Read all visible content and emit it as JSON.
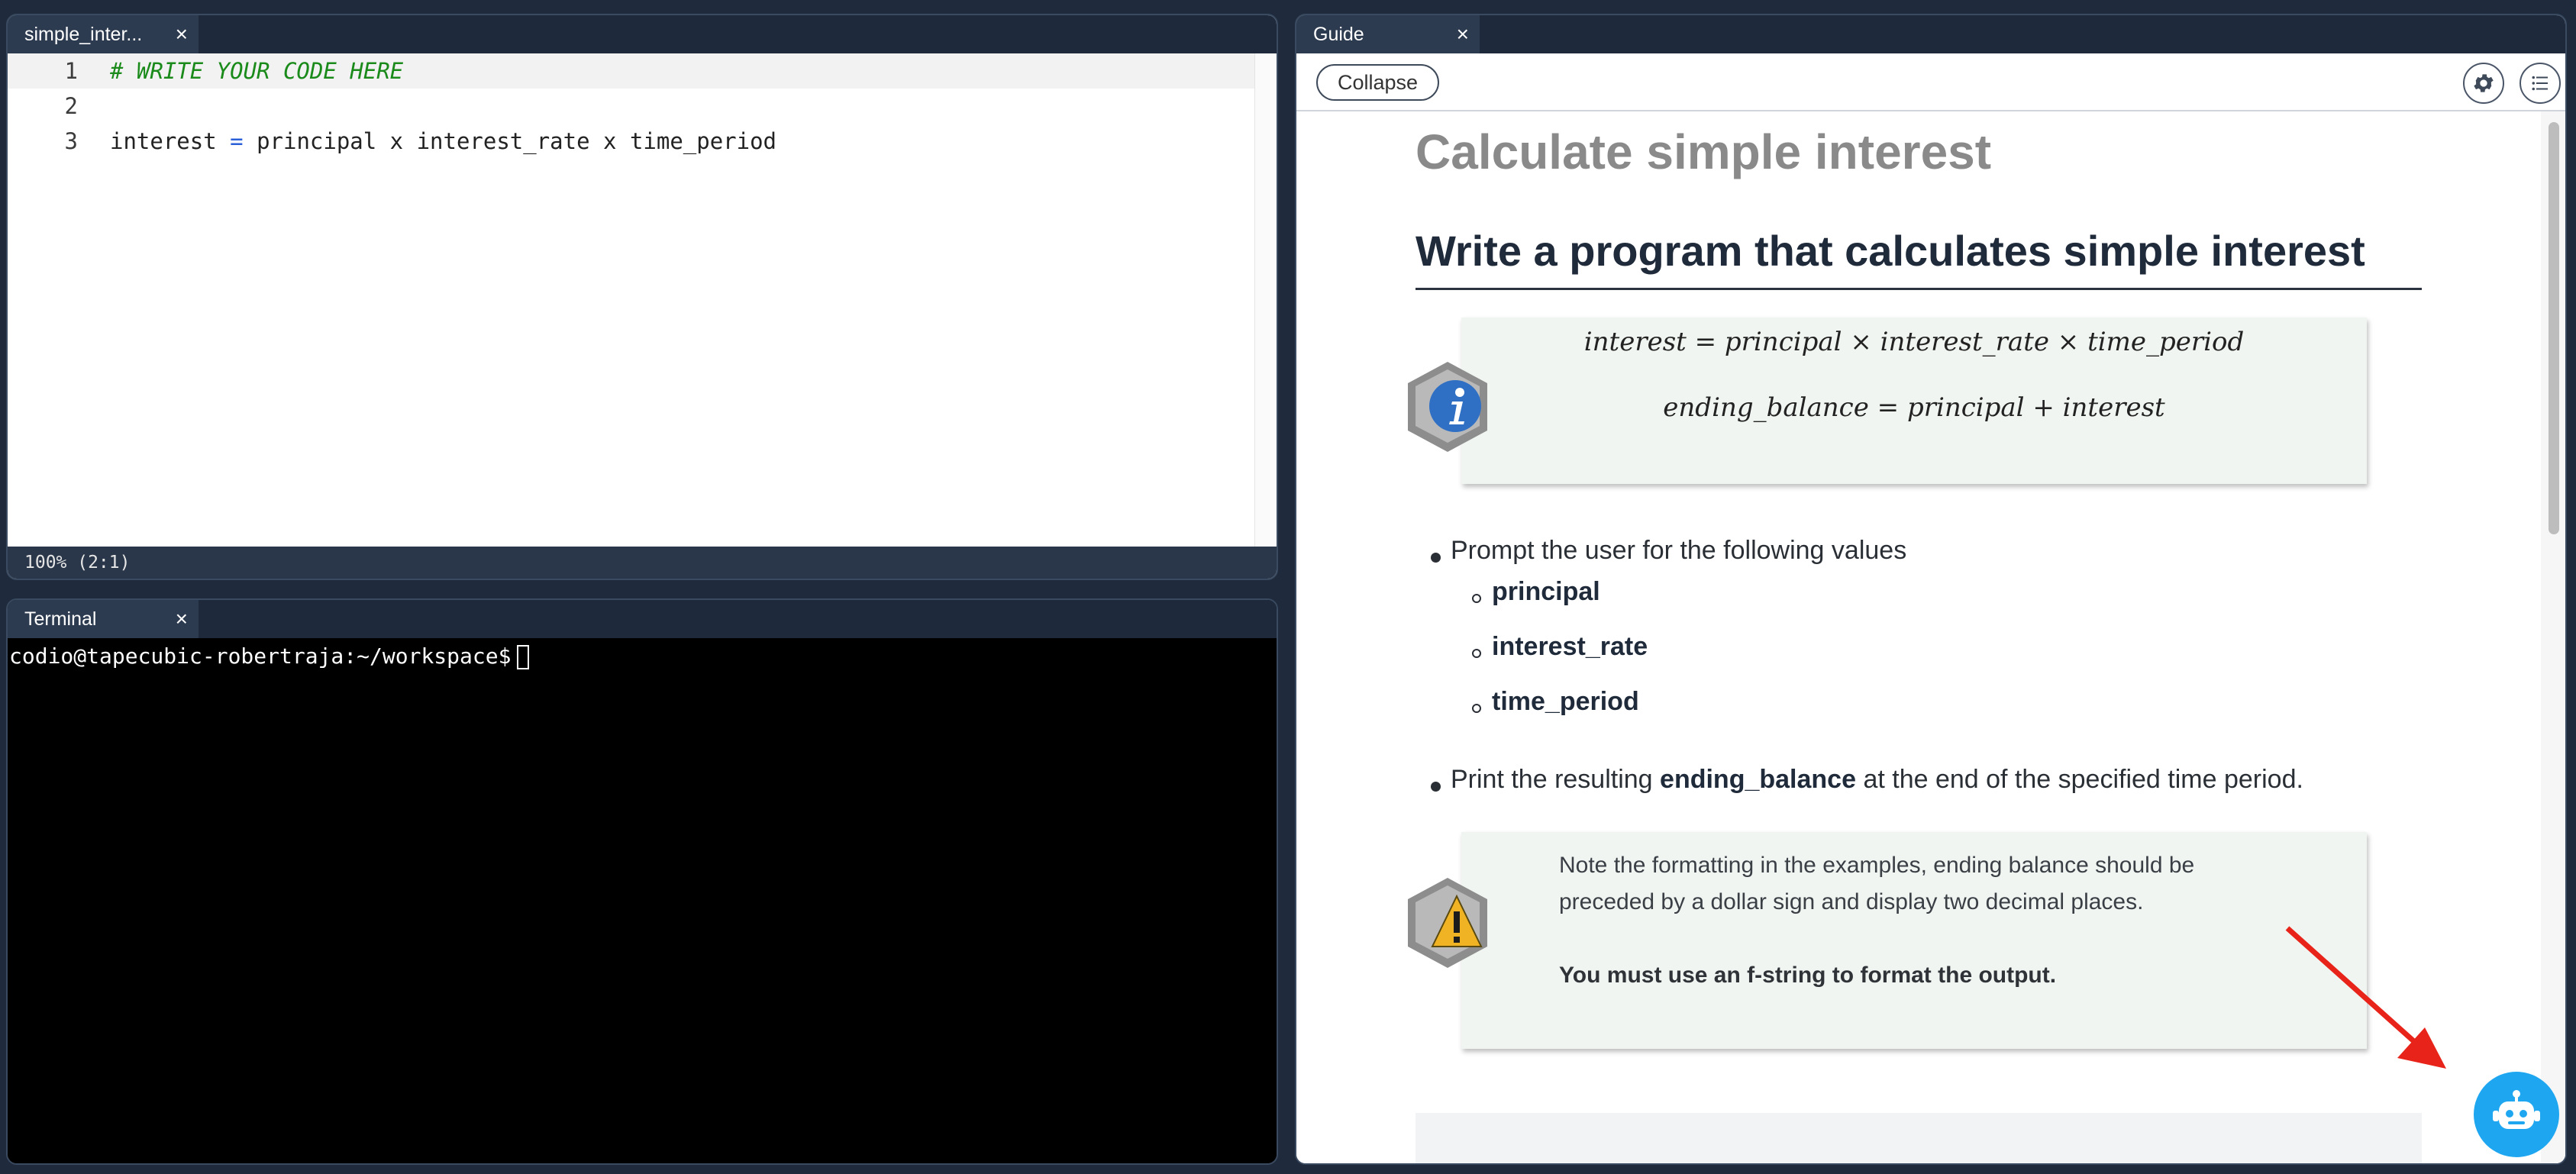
{
  "editor": {
    "tab_label": "simple_inter...",
    "close_glyph": "×",
    "lines": [
      {
        "number": "1",
        "text": "# WRITE YOUR CODE HERE"
      },
      {
        "number": "2",
        "text": ""
      },
      {
        "number": "3",
        "parts": [
          "interest",
          " = ",
          "principal x interest_rate x time_period"
        ]
      }
    ],
    "status": "100%  (2:1)"
  },
  "terminal": {
    "tab_label": "Terminal",
    "close_glyph": "×",
    "prompt": "codio@tapecubic-robertraja:~/workspace$"
  },
  "guide": {
    "tab_label": "Guide",
    "close_glyph": "×",
    "collapse_label": "Collapse",
    "settings_icon": "gear-icon",
    "toc_icon": "list-icon",
    "title": "Calculate simple interest",
    "subtitle": "Write a program that calculates simple interest",
    "formula_1": "interest = principal × interest_rate × time_period",
    "formula_2": "ending_balance = principal + interest",
    "bullet_1": "Prompt the user for the following values",
    "sub_items": [
      "principal",
      "interest_rate",
      "time_period"
    ],
    "bullet_2_pre": "Print the resulting ",
    "bullet_2_bold": "ending_balance",
    "bullet_2_post": " at the end of the specified time period.",
    "note_line_1": "Note the formatting in the examples, ending balance should be",
    "note_line_2": "preceded by a dollar sign and display two decimal places.",
    "note_bold": "You must use an f-string to format the output."
  },
  "colors": {
    "background": "#1f2b3d",
    "tab_active": "#2d3b50",
    "comment": "#1a8a1a",
    "operator": "#2b5fd8",
    "callout_bg": "#f1f5f1",
    "info_icon": "#2f6fc4",
    "warning_icon": "#f0b323",
    "arrow": "#e8241a",
    "assistant_button": "#1ea7f0"
  }
}
